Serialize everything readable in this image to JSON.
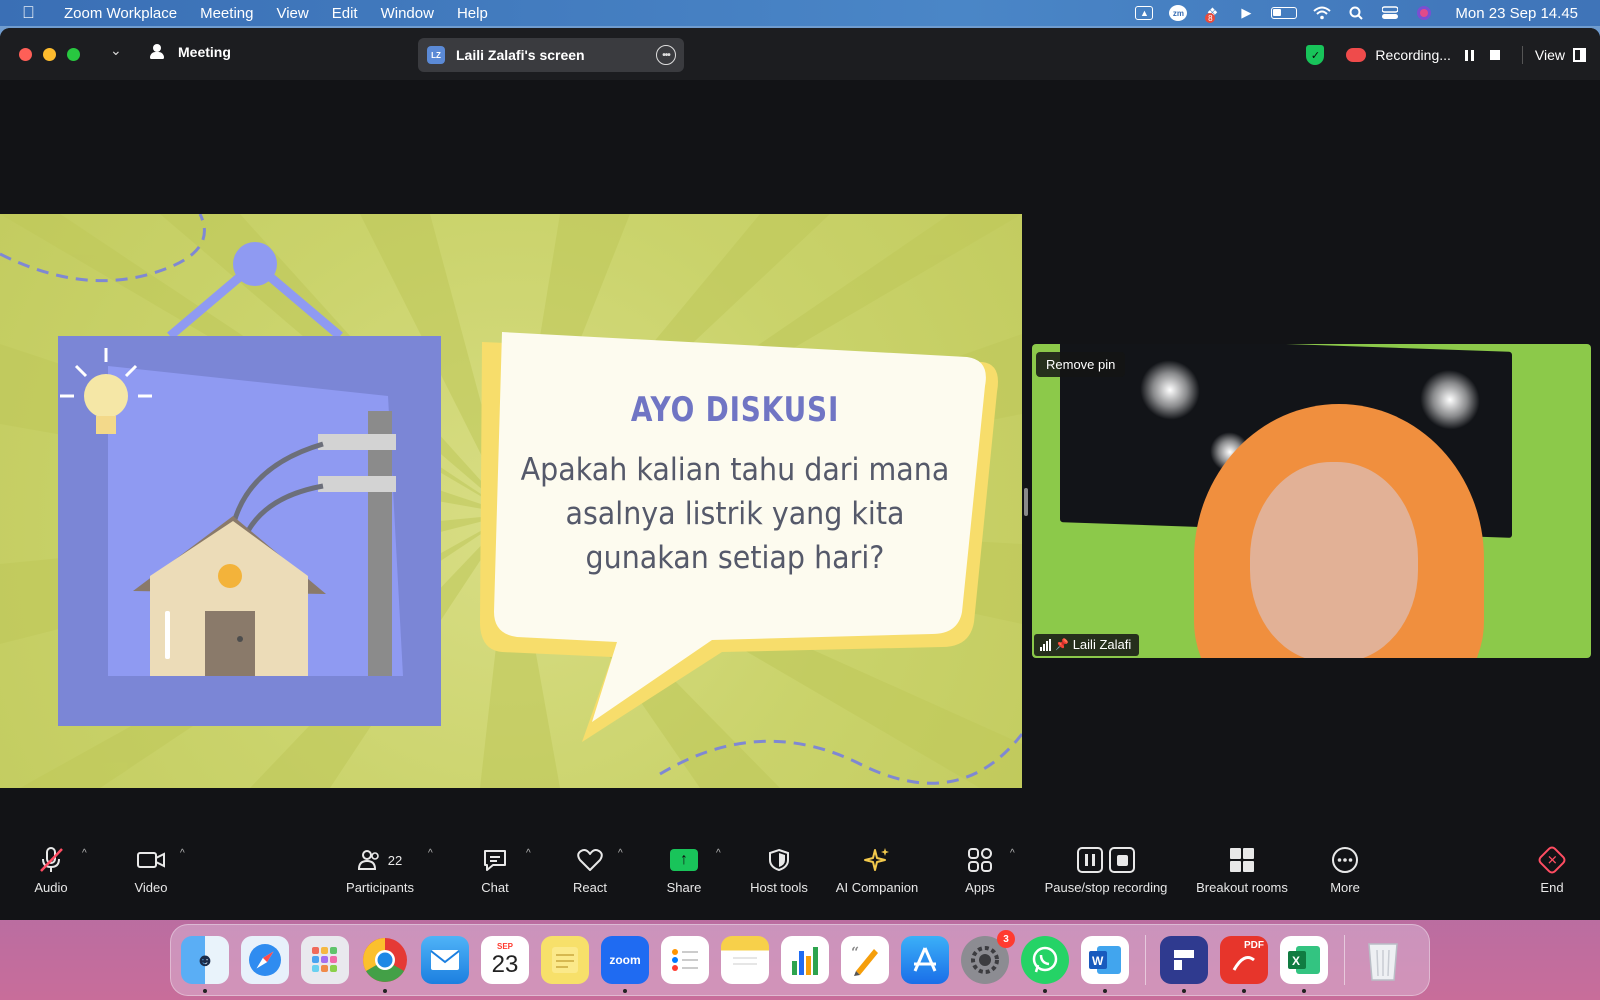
{
  "menubar": {
    "app_name": "Zoom Workplace",
    "items": [
      "Meeting",
      "View",
      "Edit",
      "Window",
      "Help"
    ],
    "clock": "Mon 23 Sep  14.45",
    "tray_icons": [
      "dropbox-like-icon",
      "zoom-tray-icon",
      "dropbox-icon",
      "play-icon",
      "battery-icon",
      "wifi-icon",
      "search-icon",
      "control-center-icon",
      "siri-icon"
    ],
    "tray_badge": "8"
  },
  "titlebar": {
    "meeting_label": "Meeting",
    "screen_share_label": "Laili Zalafi's screen",
    "screen_share_initials": "LZ",
    "recording_label": "Recording...",
    "view_label": "View"
  },
  "slide": {
    "title": "AYO DISKUSI",
    "question": "Apakah kalian tahu dari mana asalnya listrik yang kita gunakan setiap hari?"
  },
  "video_tile": {
    "remove_pin_label": "Remove pin",
    "participant_name": "Laili Zalafi"
  },
  "toolbar": {
    "audio": "Audio",
    "video": "Video",
    "participants": "Participants",
    "participants_count": "22",
    "chat": "Chat",
    "react": "React",
    "share": "Share",
    "host_tools": "Host tools",
    "ai_companion": "AI Companion",
    "apps": "Apps",
    "pause_stop_recording": "Pause/stop recording",
    "breakout_rooms": "Breakout rooms",
    "more": "More",
    "end": "End"
  },
  "dock": {
    "calendar_month": "SEP",
    "calendar_day": "23",
    "zoom_label": "zoom",
    "settings_badge": "3",
    "pdf_label": "PDF"
  },
  "colors": {
    "accent_green": "#19c45a",
    "end_red": "#ff4d62",
    "slide_bg": "#cad36b",
    "slide_title": "#7075c4"
  }
}
